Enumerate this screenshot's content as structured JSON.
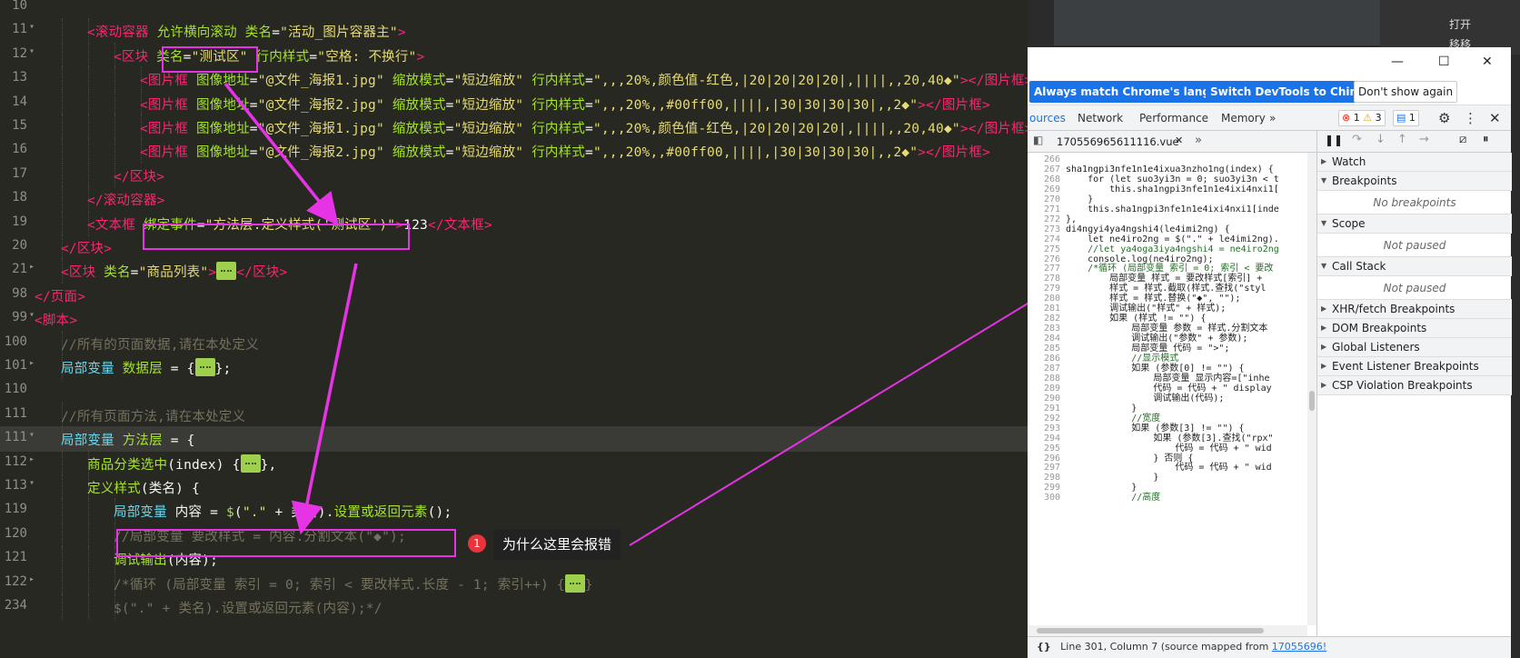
{
  "editor": {
    "lines": [
      {
        "num": "10",
        "fold": "",
        "tokens": []
      },
      {
        "num": "11",
        "fold": "▾",
        "indent": 2,
        "tokens": [
          [
            "tg",
            "<滚动容器 "
          ],
          [
            "at",
            "允许横向滚动 类名"
          ],
          [
            "ws",
            "="
          ],
          [
            "st",
            "\"活动_图片容器主\""
          ],
          [
            "tg",
            ">"
          ]
        ]
      },
      {
        "num": "12",
        "fold": "▾",
        "indent": 3,
        "tokens": [
          [
            "tg",
            "<区块 "
          ],
          [
            "at",
            "类名"
          ],
          [
            "ws",
            "="
          ],
          [
            "st",
            "\"测试区\""
          ],
          [
            "ws",
            " "
          ],
          [
            "at",
            "行内样式"
          ],
          [
            "ws",
            "="
          ],
          [
            "st",
            "\"空格: 不换行\""
          ],
          [
            "tg",
            ">"
          ]
        ]
      },
      {
        "num": "13",
        "fold": "",
        "indent": 4,
        "tokens": [
          [
            "tg",
            "<图片框 "
          ],
          [
            "at",
            "图像地址"
          ],
          [
            "ws",
            "="
          ],
          [
            "st",
            "\"@文件_海报1.jpg\""
          ],
          [
            "ws",
            " "
          ],
          [
            "at",
            "缩放模式"
          ],
          [
            "ws",
            "="
          ],
          [
            "st",
            "\"短边缩放\""
          ],
          [
            "ws",
            " "
          ],
          [
            "at",
            "行内样式"
          ],
          [
            "ws",
            "="
          ],
          [
            "st",
            "\",,,20%,颜色值-红色,|20|20|20|20|,||||,,20,40◆\""
          ],
          [
            "tg",
            "></图片框>"
          ]
        ]
      },
      {
        "num": "14",
        "fold": "",
        "indent": 4,
        "tokens": [
          [
            "tg",
            "<图片框 "
          ],
          [
            "at",
            "图像地址"
          ],
          [
            "ws",
            "="
          ],
          [
            "st",
            "\"@文件_海报2.jpg\""
          ],
          [
            "ws",
            " "
          ],
          [
            "at",
            "缩放模式"
          ],
          [
            "ws",
            "="
          ],
          [
            "st",
            "\"短边缩放\""
          ],
          [
            "ws",
            " "
          ],
          [
            "at",
            "行内样式"
          ],
          [
            "ws",
            "="
          ],
          [
            "st",
            "\",,,20%,,#00ff00,||||,|30|30|30|30|,,2◆\""
          ],
          [
            "tg",
            "></图片框>"
          ]
        ]
      },
      {
        "num": "15",
        "fold": "",
        "indent": 4,
        "tokens": [
          [
            "tg",
            "<图片框 "
          ],
          [
            "at",
            "图像地址"
          ],
          [
            "ws",
            "="
          ],
          [
            "st",
            "\"@文件_海报1.jpg\""
          ],
          [
            "ws",
            " "
          ],
          [
            "at",
            "缩放模式"
          ],
          [
            "ws",
            "="
          ],
          [
            "st",
            "\"短边缩放\""
          ],
          [
            "ws",
            " "
          ],
          [
            "at",
            "行内样式"
          ],
          [
            "ws",
            "="
          ],
          [
            "st",
            "\",,,20%,颜色值-红色,|20|20|20|20|,||||,,20,40◆\""
          ],
          [
            "tg",
            "></图片框>"
          ]
        ]
      },
      {
        "num": "16",
        "fold": "",
        "indent": 4,
        "tokens": [
          [
            "tg",
            "<图片框 "
          ],
          [
            "at",
            "图像地址"
          ],
          [
            "ws",
            "="
          ],
          [
            "st",
            "\"@文件_海报2.jpg\""
          ],
          [
            "ws",
            " "
          ],
          [
            "at",
            "缩放模式"
          ],
          [
            "ws",
            "="
          ],
          [
            "st",
            "\"短边缩放\""
          ],
          [
            "ws",
            " "
          ],
          [
            "at",
            "行内样式"
          ],
          [
            "ws",
            "="
          ],
          [
            "st",
            "\",,,20%,,#00ff00,||||,|30|30|30|30|,,2◆\""
          ],
          [
            "tg",
            "></图片框>"
          ]
        ]
      },
      {
        "num": "17",
        "fold": "",
        "indent": 3,
        "tokens": [
          [
            "tg",
            "</区块>"
          ]
        ]
      },
      {
        "num": "18",
        "fold": "",
        "indent": 2,
        "tokens": [
          [
            "tg",
            "</滚动容器>"
          ]
        ]
      },
      {
        "num": "19",
        "fold": "",
        "indent": 2,
        "tokens": [
          [
            "tg",
            "<文本框 "
          ],
          [
            "at",
            "绑定事件"
          ],
          [
            "ws",
            "="
          ],
          [
            "st",
            "\"方法层.定义样式('测试区')\""
          ],
          [
            "tg",
            ">"
          ],
          [
            "ws",
            "123"
          ],
          [
            "tg",
            "</文本框>"
          ]
        ]
      },
      {
        "num": "20",
        "fold": "",
        "indent": 1,
        "tokens": [
          [
            "tg",
            "</区块>"
          ]
        ]
      },
      {
        "num": "21",
        "fold": "▸",
        "indent": 1,
        "tokens": [
          [
            "tg",
            "<区块 "
          ],
          [
            "at",
            "类名"
          ],
          [
            "ws",
            "="
          ],
          [
            "st",
            "\"商品列表\""
          ],
          [
            "tg",
            ">"
          ],
          [
            "box",
            ""
          ],
          [
            "tg",
            "</区块>"
          ]
        ]
      },
      {
        "num": "98",
        "fold": "",
        "indent": 0,
        "tokens": [
          [
            "tg",
            "</页面>"
          ]
        ]
      },
      {
        "num": "99",
        "fold": "▾",
        "indent": 0,
        "tokens": [
          [
            "tg",
            "<脚本>"
          ]
        ]
      },
      {
        "num": "100",
        "fold": "",
        "indent": 1,
        "tokens": [
          [
            "cm",
            "//所有的页面数据,请在本处定义"
          ]
        ]
      },
      {
        "num": "101",
        "fold": "▸",
        "indent": 1,
        "tokens": [
          [
            "kw",
            "局部变量 "
          ],
          [
            "fn",
            "数据层"
          ],
          [
            "ws",
            " = {"
          ],
          [
            "box",
            ""
          ],
          [
            "ws",
            "};"
          ]
        ]
      },
      {
        "num": "110",
        "fold": "",
        "tokens": []
      },
      {
        "num": "111",
        "fold": "",
        "indent": 1,
        "tokens": [
          [
            "cm",
            "//所有页面方法,请在本处定义"
          ]
        ]
      },
      {
        "num": "111",
        "fold": "▾",
        "indent": 1,
        "current": true,
        "tokens": [
          [
            "kw",
            "局部变量 "
          ],
          [
            "fn",
            "方法层"
          ],
          [
            "ws",
            " = {"
          ]
        ]
      },
      {
        "num": "112",
        "fold": "▸",
        "indent": 2,
        "tokens": [
          [
            "fn",
            "商品分类选中"
          ],
          [
            "ws",
            "(index) {"
          ],
          [
            "box",
            ""
          ],
          [
            "ws",
            "},"
          ]
        ]
      },
      {
        "num": "113",
        "fold": "▾",
        "indent": 2,
        "tokens": [
          [
            "fn",
            "定义样式"
          ],
          [
            "ws",
            "(类名) {"
          ]
        ]
      },
      {
        "num": "119",
        "fold": "",
        "indent": 3,
        "tokens": [
          [
            "kw",
            "局部变量 "
          ],
          [
            "ws",
            "内容 = "
          ],
          [
            "fn",
            "$"
          ],
          [
            "ws",
            "("
          ],
          [
            "st",
            "\".\""
          ],
          [
            "ws",
            " + 类名)."
          ],
          [
            "fn",
            "设置或返回元素"
          ],
          [
            "ws",
            "();"
          ]
        ]
      },
      {
        "num": "120",
        "fold": "",
        "indent": 3,
        "tokens": [
          [
            "cm",
            "//局部变量 要改样式 = 内容.分割文本(\"◆\");"
          ]
        ]
      },
      {
        "num": "121",
        "fold": "",
        "indent": 3,
        "tokens": [
          [
            "fn",
            "调试输出"
          ],
          [
            "ws",
            "(内容);"
          ]
        ]
      },
      {
        "num": "122",
        "fold": "▸",
        "indent": 3,
        "tokens": [
          [
            "cm",
            "/*循环 (局部变量 索引 = 0; 索引 < 要改样式.长度 - 1; 索引++) {"
          ],
          [
            "box",
            ""
          ],
          [
            "cm",
            "}"
          ]
        ]
      },
      {
        "num": "234",
        "fold": "",
        "indent": 3,
        "tokens": [
          [
            "cm",
            "$(\".\" + 类名).设置或返回元素(内容);*/"
          ]
        ]
      }
    ],
    "annotation": {
      "badge": "1",
      "text": "为什么这里会报错"
    }
  },
  "background_window": {
    "menu": [
      "打开",
      "移移"
    ]
  },
  "devtools": {
    "window_controls": [
      "—",
      "☐",
      "✕"
    ],
    "infobar": {
      "match_language": "Always match Chrome's language",
      "switch_chinese": "Switch DevTools to Chinese",
      "dont_show": "Don't show again"
    },
    "tabs": [
      "ources",
      "Network",
      "Performance",
      "Memory",
      "»"
    ],
    "counters": {
      "errors": "1",
      "warnings": "3",
      "messages": "1"
    },
    "file_tab": "170556965611116.vue",
    "source_lines": [
      {
        "n": "266",
        "c": ""
      },
      {
        "n": "267",
        "c": "sha1ngpi3nfe1n1e4ixua3nzho1ng(index) {"
      },
      {
        "n": "268",
        "c": "    for (let suo3yi3n = 0; suo3yi3n < t"
      },
      {
        "n": "269",
        "c": "        this.sha1ngpi3nfe1n1e4ixi4nxi1["
      },
      {
        "n": "270",
        "c": "    }"
      },
      {
        "n": "271",
        "c": "    this.sha1ngpi3nfe1n1e4ixi4nxi1[inde"
      },
      {
        "n": "272",
        "c": "},"
      },
      {
        "n": "273",
        "c": "di4ngyi4ya4ngshi4(le4imi2ng) {"
      },
      {
        "n": "274",
        "c": "    let ne4iro2ng = $(\".\" + le4imi2ng)."
      },
      {
        "n": "275",
        "c": "    //let ya4oga3iya4ngshi4 = ne4iro2ng"
      },
      {
        "n": "276",
        "c": "    console.log(ne4iro2ng);"
      },
      {
        "n": "277",
        "c": "    /*循环 (局部变量 索引 = 0; 索引 < 要改"
      },
      {
        "n": "278",
        "c": "        局部变量 样式 = 要改样式[索引] +"
      },
      {
        "n": "279",
        "c": "        样式 = 样式.截取(样式.查找(\"styl"
      },
      {
        "n": "280",
        "c": "        样式 = 样式.替换(\"◆\", \"\");"
      },
      {
        "n": "281",
        "c": "        调试输出(\"样式\" + 样式);"
      },
      {
        "n": "282",
        "c": "        如果 (样式 != \"\") {"
      },
      {
        "n": "283",
        "c": "            局部变量 参数 = 样式.分割文本"
      },
      {
        "n": "284",
        "c": "            调试输出(\"参数\" + 参数);"
      },
      {
        "n": "285",
        "c": "            局部变量 代码 = \">\";"
      },
      {
        "n": "286",
        "c": "            //显示模式"
      },
      {
        "n": "287",
        "c": "            如果 (参数[0] != \"\") {"
      },
      {
        "n": "288",
        "c": "                局部变量 显示内容=[\"inhe"
      },
      {
        "n": "289",
        "c": "                代码 = 代码 + \" display"
      },
      {
        "n": "290",
        "c": "                调试输出(代码);"
      },
      {
        "n": "291",
        "c": "            }"
      },
      {
        "n": "292",
        "c": "            //宽度"
      },
      {
        "n": "293",
        "c": "            如果 (参数[3] != \"\") {"
      },
      {
        "n": "294",
        "c": "                如果 (参数[3].查找(\"rpx\""
      },
      {
        "n": "295",
        "c": "                    代码 = 代码 + \" wid"
      },
      {
        "n": "296",
        "c": "                } 否则 {"
      },
      {
        "n": "297",
        "c": "                    代码 = 代码 + \" wid"
      },
      {
        "n": "298",
        "c": "                }"
      },
      {
        "n": "299",
        "c": "            }"
      },
      {
        "n": "300",
        "c": "            //高度"
      }
    ],
    "status": {
      "position": "Line 301, Column 7",
      "mapped": "(source mapped from",
      "link": "17055696!"
    },
    "panels": [
      {
        "title": "Watch",
        "body": ""
      },
      {
        "title": "Breakpoints",
        "body": "No breakpoints"
      },
      {
        "title": "Scope",
        "body": "Not paused"
      },
      {
        "title": "Call Stack",
        "body": "Not paused"
      },
      {
        "title": "XHR/fetch Breakpoints",
        "body": ""
      },
      {
        "title": "DOM Breakpoints",
        "body": ""
      },
      {
        "title": "Global Listeners",
        "body": ""
      },
      {
        "title": "Event Listener Breakpoints",
        "body": ""
      },
      {
        "title": "CSP Violation Breakpoints",
        "body": ""
      }
    ]
  },
  "colors": {
    "highlight": "#e633e6",
    "editor_bg": "#272822",
    "devtools_blue": "#1a73e8"
  }
}
